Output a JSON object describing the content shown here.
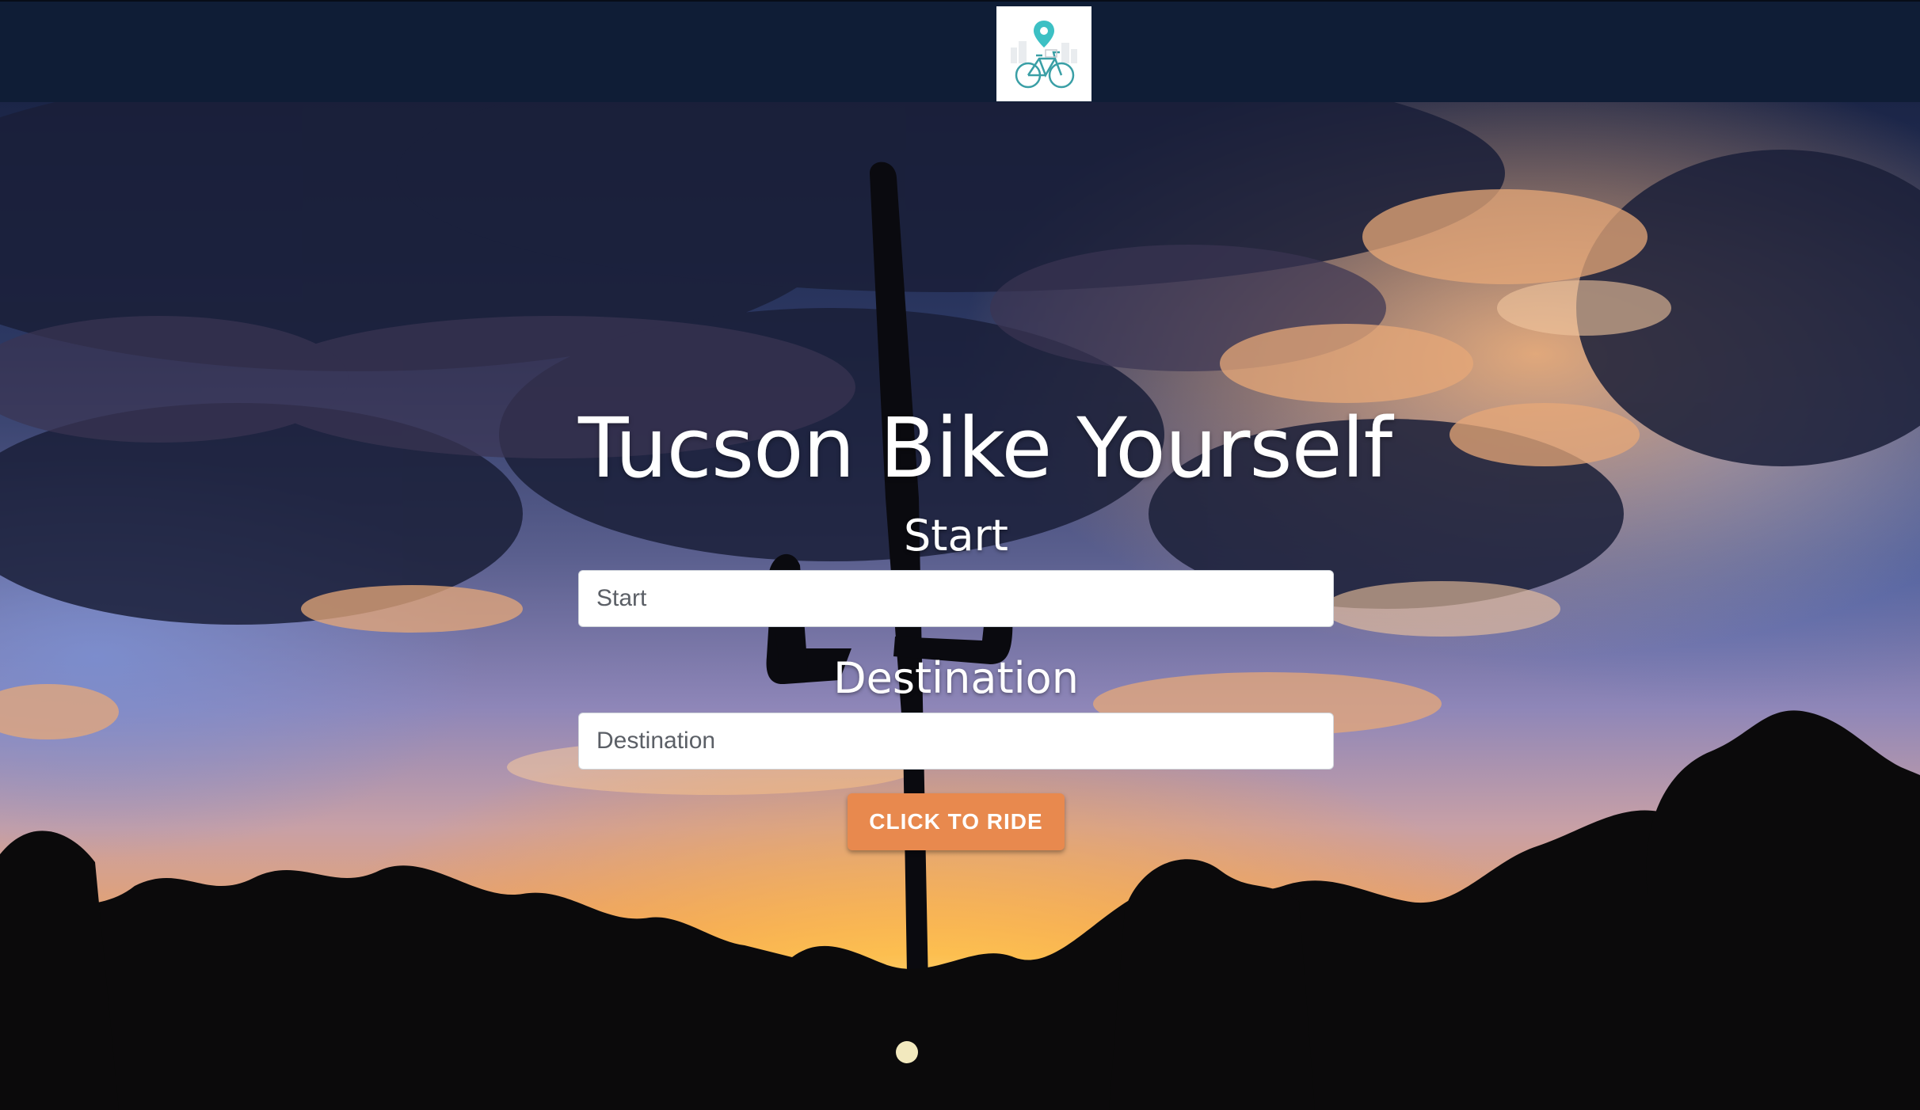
{
  "navbar": {
    "logo_icon": "bike-location-logo-icon",
    "logo_alt": "Tucson Bike Yourself logo"
  },
  "hero": {
    "title": "Tucson Bike Yourself",
    "start_label": "Start",
    "start_placeholder": "Start",
    "start_value": "",
    "destination_label": "Destination",
    "destination_placeholder": "Destination",
    "destination_value": "",
    "submit_label": "CLICK TO RIDE"
  },
  "colors": {
    "navbar_bg": "#0f1d36",
    "button_bg": "#e8894e",
    "logo_teal": "#3cc0c4"
  }
}
